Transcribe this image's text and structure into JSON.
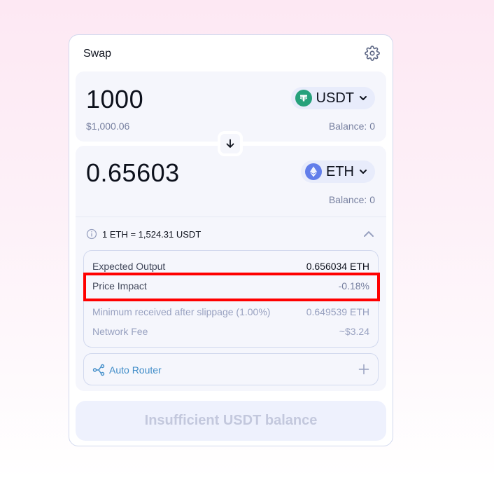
{
  "swap": {
    "title": "Swap",
    "input": {
      "amount": "1000",
      "usd_value": "$1,000.06",
      "balance": "Balance: 0",
      "token": "USDT",
      "token_color": "#26a17b"
    },
    "output": {
      "amount": "0.65603",
      "balance": "Balance: 0",
      "token": "ETH",
      "token_color": "#627eea"
    },
    "rate": "1 ETH = 1,524.31 USDT",
    "details": {
      "expected_output_label": "Expected Output",
      "expected_output_value": "0.656034 ETH",
      "price_impact_label": "Price Impact",
      "price_impact_value": "-0.18%",
      "min_received_label": "Minimum received after slippage (1.00%)",
      "min_received_value": "0.649539 ETH",
      "network_fee_label": "Network Fee",
      "network_fee_value": "~$3.24"
    },
    "router_label": "Auto Router",
    "cta_label": "Insufficient USDT balance"
  },
  "colors": {
    "highlight": "#ff0000",
    "accent": "#3f8cc8"
  },
  "icons": [
    "gear-icon",
    "usdt-icon",
    "eth-icon",
    "chevron-down-icon",
    "arrow-down-icon",
    "info-icon",
    "chevron-up-icon",
    "router-icon",
    "plus-icon"
  ]
}
